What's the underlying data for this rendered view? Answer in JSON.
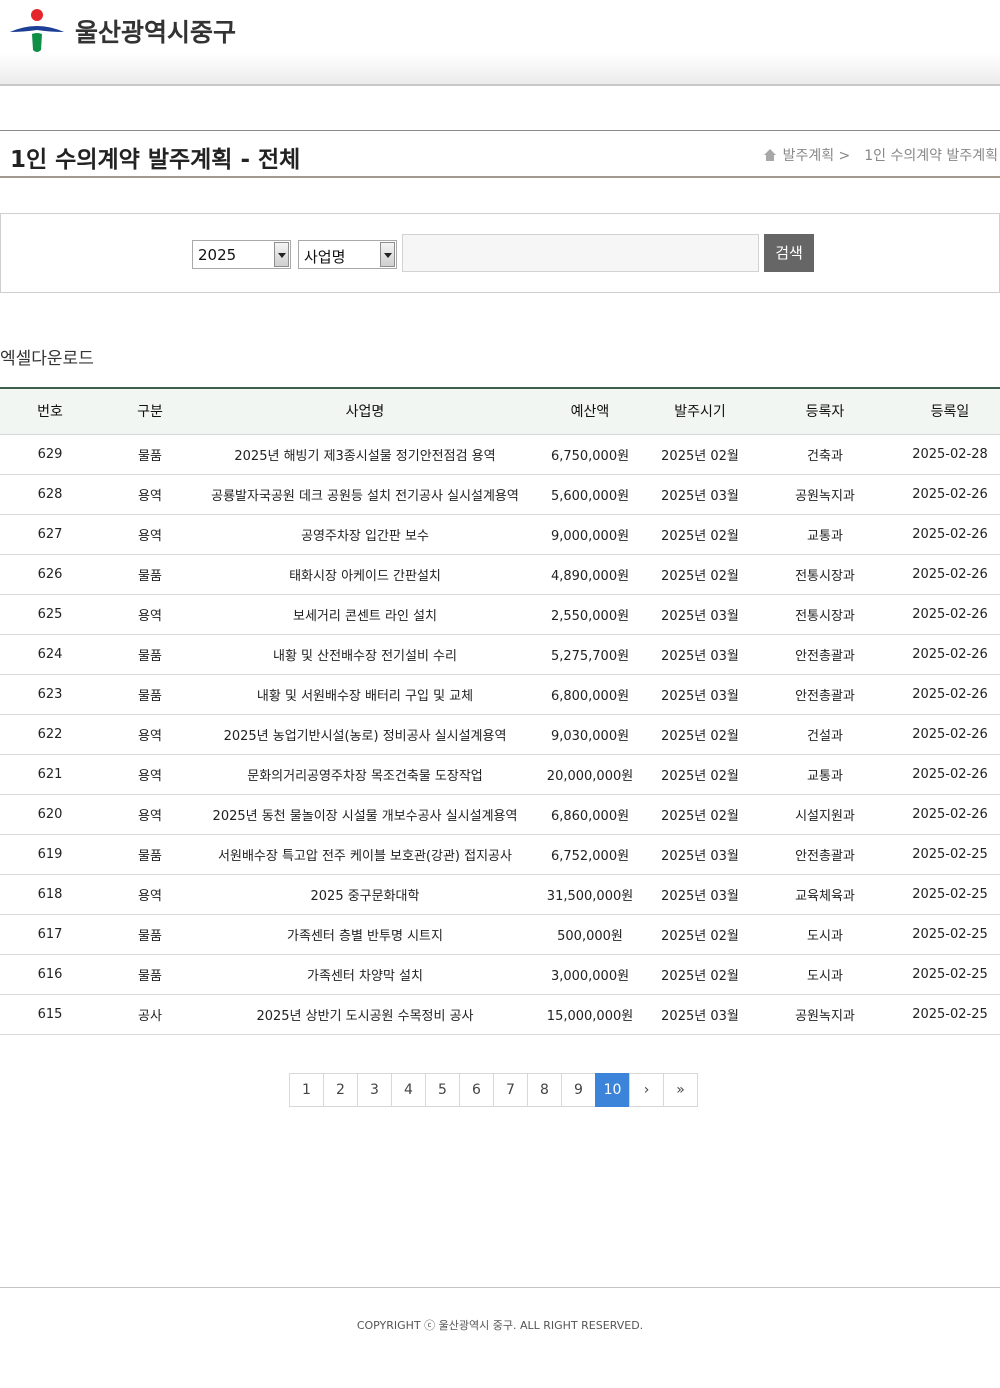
{
  "header": {
    "org_name": "울산광역시중구"
  },
  "title_bar": {
    "page_title": "1인 수의계약 발주계획 - 전체",
    "breadcrumb": [
      "발주계획 >",
      "1인 수의계약 발주계획"
    ]
  },
  "search": {
    "year": "2025",
    "field": "사업명",
    "query": "",
    "button": "검색"
  },
  "excel_download": "엑셀다운로드",
  "table": {
    "headers": [
      "번호",
      "구분",
      "사업명",
      "예산액",
      "발주시기",
      "등록자",
      "등록일"
    ],
    "rows": [
      [
        "629",
        "물품",
        "2025년 해빙기 제3종시설물 정기안전점검 용역",
        "6,750,000원",
        "2025년 02월",
        "건축과",
        "2025-02-28"
      ],
      [
        "628",
        "용역",
        "공룡발자국공원 데크 공원등 설치 전기공사 실시설계용역",
        "5,600,000원",
        "2025년 03월",
        "공원녹지과",
        "2025-02-26"
      ],
      [
        "627",
        "용역",
        "공영주차장 입간판 보수",
        "9,000,000원",
        "2025년 02월",
        "교통과",
        "2025-02-26"
      ],
      [
        "626",
        "물품",
        "태화시장 아케이드 간판설치",
        "4,890,000원",
        "2025년 02월",
        "전통시장과",
        "2025-02-26"
      ],
      [
        "625",
        "용역",
        "보세거리 콘센트 라인 설치",
        "2,550,000원",
        "2025년 03월",
        "전통시장과",
        "2025-02-26"
      ],
      [
        "624",
        "물품",
        "내황 및 산전배수장 전기설비 수리",
        "5,275,700원",
        "2025년 03월",
        "안전총괄과",
        "2025-02-26"
      ],
      [
        "623",
        "물품",
        "내황 및 서원배수장 배터리 구입 및 교체",
        "6,800,000원",
        "2025년 03월",
        "안전총괄과",
        "2025-02-26"
      ],
      [
        "622",
        "용역",
        "2025년 농업기반시설(농로) 정비공사 실시설계용역",
        "9,030,000원",
        "2025년 02월",
        "건설과",
        "2025-02-26"
      ],
      [
        "621",
        "용역",
        "문화의거리공영주차장 목조건축물 도장작업",
        "20,000,000원",
        "2025년 02월",
        "교통과",
        "2025-02-26"
      ],
      [
        "620",
        "용역",
        "2025년 동천 물놀이장 시설물 개보수공사 실시설계용역",
        "6,860,000원",
        "2025년 02월",
        "시설지원과",
        "2025-02-26"
      ],
      [
        "619",
        "물품",
        "서원배수장 특고압 전주 케이블 보호관(강관) 접지공사",
        "6,752,000원",
        "2025년 03월",
        "안전총괄과",
        "2025-02-25"
      ],
      [
        "618",
        "용역",
        "2025 중구문화대학",
        "31,500,000원",
        "2025년 03월",
        "교육체육과",
        "2025-02-25"
      ],
      [
        "617",
        "물품",
        "가족센터 층별 반투명 시트지",
        "500,000원",
        "2025년 02월",
        "도시과",
        "2025-02-25"
      ],
      [
        "616",
        "물품",
        "가족센터 차양막 설치",
        "3,000,000원",
        "2025년 02월",
        "도시과",
        "2025-02-25"
      ],
      [
        "615",
        "공사",
        "2025년 상반기 도시공원 수목정비 공사",
        "15,000,000원",
        "2025년 03월",
        "공원녹지과",
        "2025-02-25"
      ]
    ]
  },
  "pagination": {
    "pages": [
      "1",
      "2",
      "3",
      "4",
      "5",
      "6",
      "7",
      "8",
      "9",
      "10"
    ],
    "current": "10",
    "next": "›",
    "last": "»"
  },
  "footer": {
    "copyright": "COPYRIGHT ⓒ 울산광역시 중구. ALL RIGHT RESERVED."
  },
  "colors": {
    "accent": "#3b84d9",
    "table_top_border": "#3f5f4e",
    "logo_red": "#e2262c",
    "logo_blue": "#1d3f95",
    "logo_green": "#0f8f45"
  },
  "icons": [
    "home-icon",
    "dropdown-arrow-icon",
    "next-page-icon",
    "last-page-icon"
  ]
}
